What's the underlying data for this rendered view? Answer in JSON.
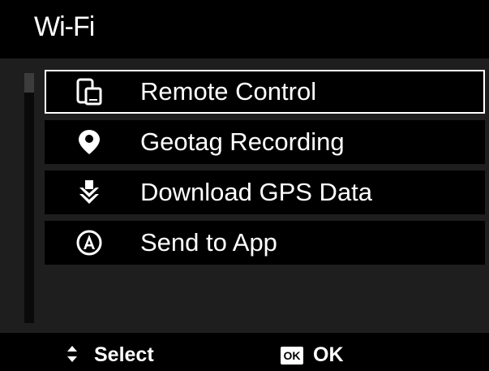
{
  "header": {
    "title": "Wi-Fi"
  },
  "menu": {
    "items": [
      {
        "label": "Remote Control",
        "icon": "phone-camera-icon",
        "selected": true
      },
      {
        "label": "Geotag Recording",
        "icon": "location-pin-icon",
        "selected": false
      },
      {
        "label": "Download GPS Data",
        "icon": "download-arrow-icon",
        "selected": false
      },
      {
        "label": "Send to App",
        "icon": "app-circle-icon",
        "selected": false
      }
    ]
  },
  "footer": {
    "select_label": "Select",
    "ok_icon_text": "OK",
    "ok_label": "OK"
  }
}
